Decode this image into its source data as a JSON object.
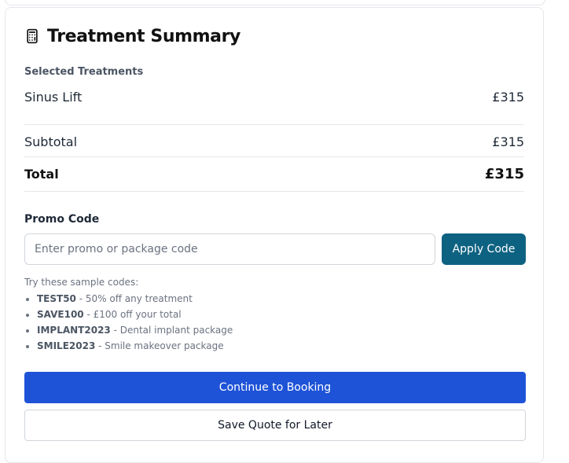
{
  "summary": {
    "title": "Treatment Summary",
    "icon": "calculator-icon",
    "selected_label": "Selected Treatments",
    "treatments": [
      {
        "name": "Sinus Lift",
        "price": "£315"
      }
    ],
    "subtotal_label": "Subtotal",
    "subtotal_value": "£315",
    "total_label": "Total",
    "total_value": "£315"
  },
  "promo": {
    "label": "Promo Code",
    "placeholder": "Enter promo or package code",
    "value": "",
    "apply_label": "Apply Code",
    "hint": "Try these sample codes:",
    "codes": [
      {
        "code": "TEST50",
        "desc": " - 50% off any treatment"
      },
      {
        "code": "SAVE100",
        "desc": " - £100 off your total"
      },
      {
        "code": "IMPLANT2023",
        "desc": " - Dental implant package"
      },
      {
        "code": "SMILE2023",
        "desc": " - Smile makeover package"
      }
    ]
  },
  "actions": {
    "continue_label": "Continue to Booking",
    "save_label": "Save Quote for Later"
  },
  "colors": {
    "apply_button": "#0e6281",
    "continue_button": "#1e53d8"
  }
}
